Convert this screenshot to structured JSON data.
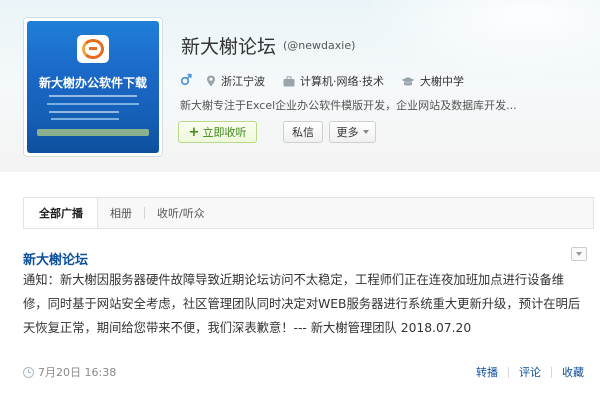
{
  "profile": {
    "name": "新大榭论坛",
    "handle": "(@newdaxie)",
    "location": "浙江宁波",
    "industry": "计算机·网络·技术",
    "school": "大榭中学",
    "bio": "新大榭专注于Excel企业办公软件模版开发，企业网站及数据库开发...",
    "avatar_title": "新大榭办公软件下载",
    "follow_label": "立即收听",
    "message_label": "私信",
    "more_label": "更多"
  },
  "tabs": [
    {
      "label": "全部广播"
    },
    {
      "label": "相册"
    },
    {
      "label": "收听/听众"
    }
  ],
  "post": {
    "author": "新大榭论坛",
    "text": "通知：新大榭因服务器硬件故障导致近期论坛访问不太稳定，工程师们正在连夜加班加点进行设备维修，同时基于网站安全考虑，社区管理团队同时决定对WEB服务器进行系统重大更新升级，预计在明后天恢复正常，期间给您带来不便，我们深表歉意！--- 新大榭管理团队 2018.07.20",
    "time": "7月20日 16:38",
    "actions": {
      "repost": "转播",
      "comment": "评论",
      "favorite": "收藏"
    }
  },
  "colors": {
    "link": "#0b4f9e",
    "follow_green": "#3c8a1a"
  },
  "icons": [
    "male-icon",
    "location-icon",
    "briefcase-icon",
    "graduation-cap-icon",
    "clock-icon"
  ]
}
